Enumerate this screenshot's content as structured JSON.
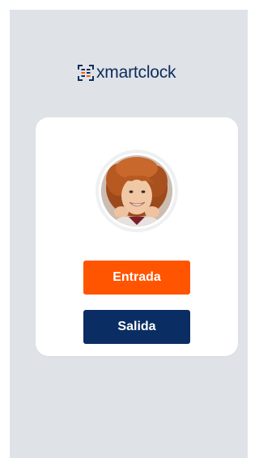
{
  "brand": {
    "logo_part_1": "xmart",
    "logo_part_2": "",
    "logo_part_3": "clock",
    "colors": {
      "navy": "#0d2b5e",
      "orange": "#ff5a00"
    }
  },
  "card": {
    "avatar_icon": "user-photo",
    "entrada_label": "Entrada",
    "salida_label": "Salida",
    "entrada_color": "#ff5500",
    "salida_color": "#0a2d63"
  }
}
